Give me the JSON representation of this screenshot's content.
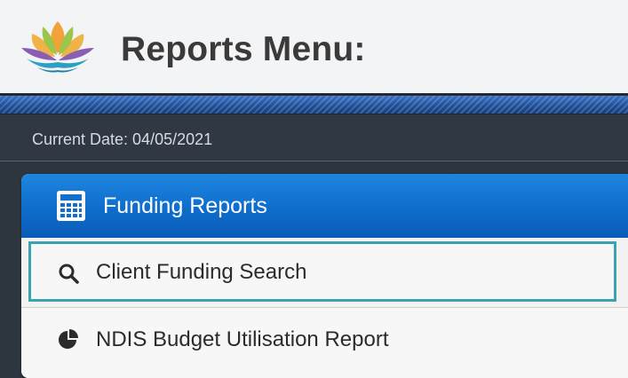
{
  "header": {
    "title": "Reports Menu:",
    "logo_icon": "lotus-logo-icon"
  },
  "date_bar": {
    "text": "Current Date: 04/05/2021"
  },
  "panel": {
    "title": "Funding Reports",
    "icon": "calculator-icon",
    "items": [
      {
        "label": "Client Funding Search",
        "icon": "search-icon",
        "selected": true
      },
      {
        "label": "NDIS Budget Utilisation Report",
        "icon": "pie-chart-icon",
        "selected": false
      }
    ]
  },
  "colors": {
    "panel_header": "#0f6fcf",
    "selected_border": "#3aa3ad",
    "stripe": "#1d4f9a",
    "background": "#2e3640"
  }
}
